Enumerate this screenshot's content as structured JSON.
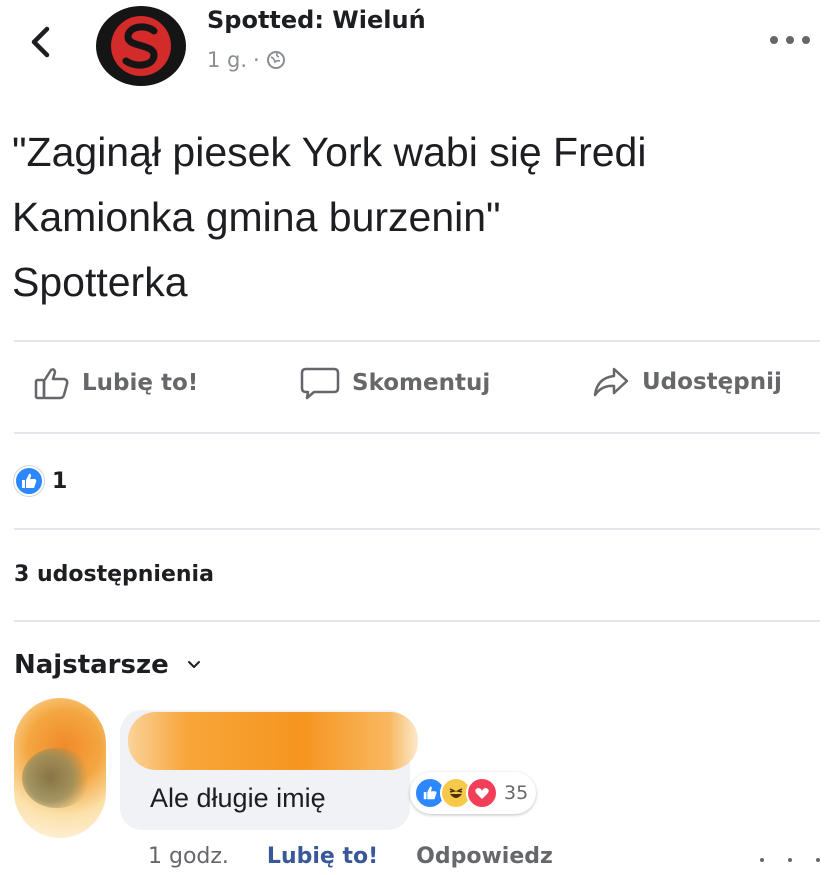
{
  "post": {
    "page_name": "Spotted: Wieluń",
    "time": "1 g.",
    "separator": "·",
    "text_lines": [
      "\"Zaginął piesek York wabi się Fredi",
      "Kamionka gmina burzenin\"",
      "Spotterka"
    ]
  },
  "icons": {
    "back": "chevron-left-icon",
    "avatar": "spotted-logo-icon",
    "privacy": "globe-icon",
    "more": "more-icon",
    "like": "thumbs-up-icon",
    "comment": "speech-bubble-icon",
    "share": "share-arrow-icon",
    "chevron": "chevron-down-icon"
  },
  "actions": {
    "like_label": "Lubię to!",
    "comment_label": "Skomentuj",
    "share_label": "Udostępnij"
  },
  "reactions": {
    "count": "1"
  },
  "shares": {
    "label": "3 udostępnienia"
  },
  "comments": {
    "sort_label": "Najstarsze",
    "items": [
      {
        "text": "Ale długie imię",
        "reaction_count": "35",
        "time": "1 godz.",
        "like_label": "Lubię to!",
        "reply_label": "Odpowiedz"
      }
    ]
  },
  "colors": {
    "like_blue": "#2d88ff",
    "text_gray": "#65676b",
    "link_blue": "#385898",
    "logo_red": "#d32a2a",
    "redaction_orange": "#f6951f"
  }
}
